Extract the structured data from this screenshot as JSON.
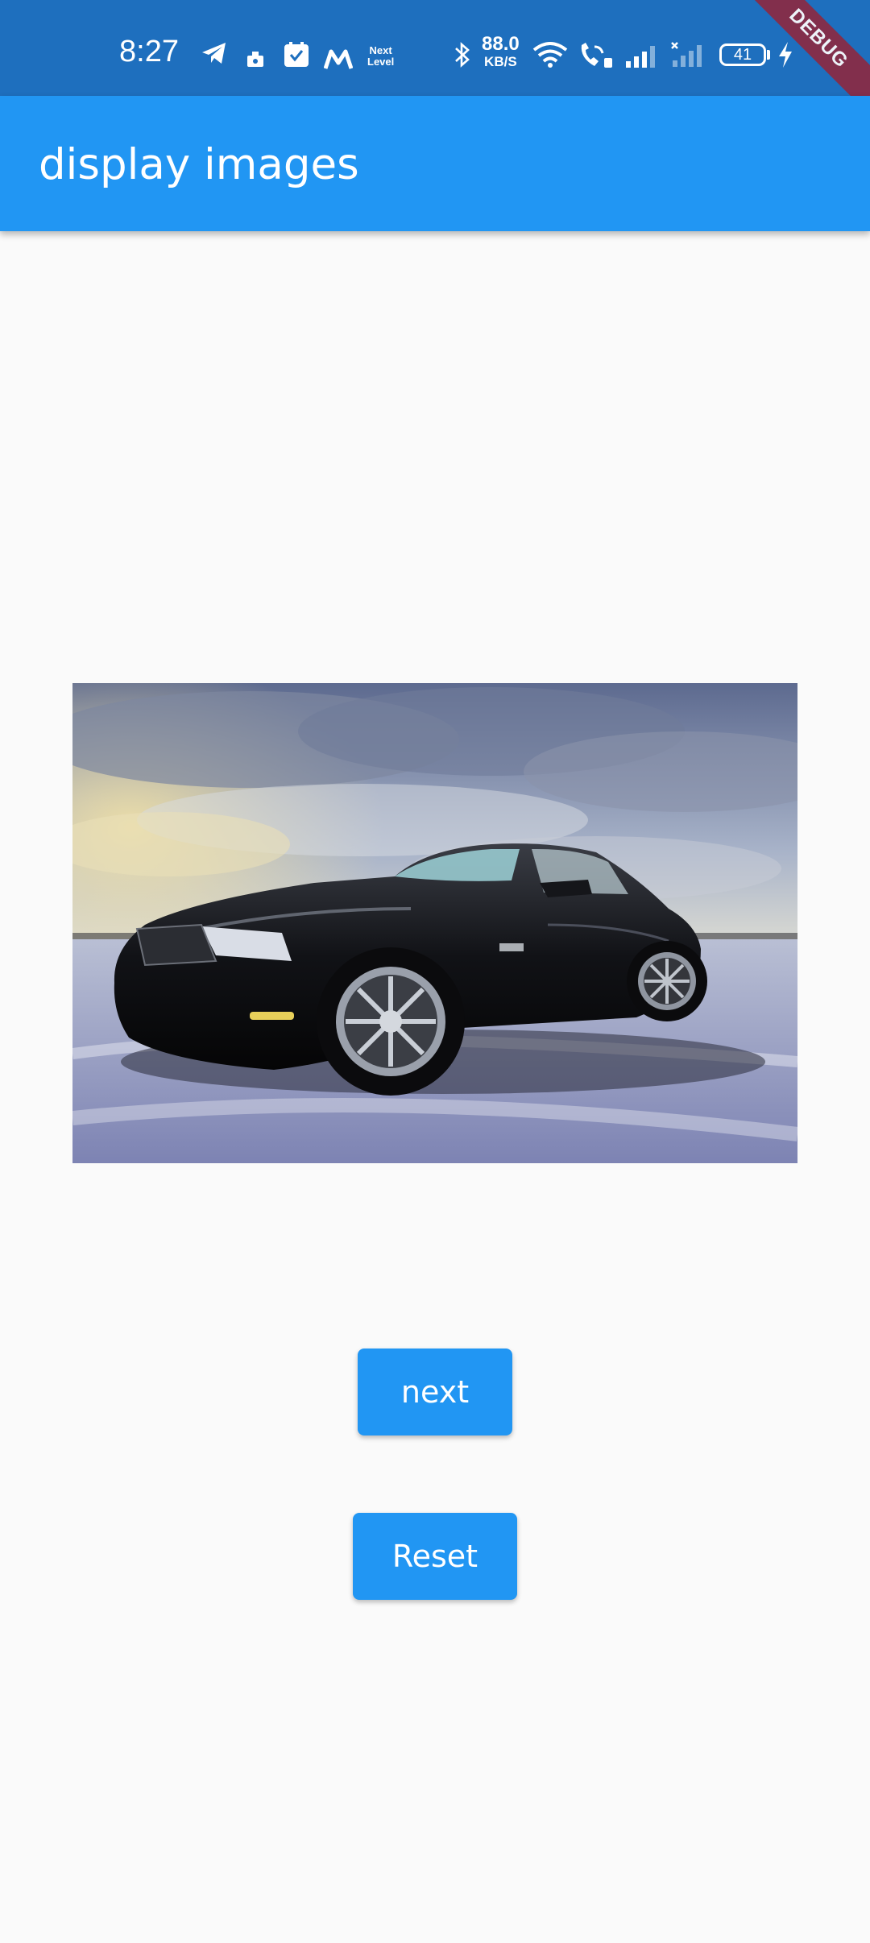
{
  "status_bar": {
    "time": "8:27",
    "notification_icons": [
      "telegram-icon",
      "app-icon",
      "calendar-icon",
      "m-app-icon"
    ],
    "next_level_line1": "Next",
    "next_level_line2": "Level",
    "speed_value": "88.0",
    "speed_unit": "KB/S",
    "battery_level": "41",
    "colors": {
      "background": "#1e6fbe"
    }
  },
  "debug_banner": "DEBUG",
  "app_bar": {
    "title": "display images",
    "color": "#2196f3"
  },
  "main": {
    "image": {
      "description_icon": "car-photo"
    },
    "next_button_label": "next",
    "reset_button_label": "Reset",
    "button_color": "#2196f3"
  }
}
